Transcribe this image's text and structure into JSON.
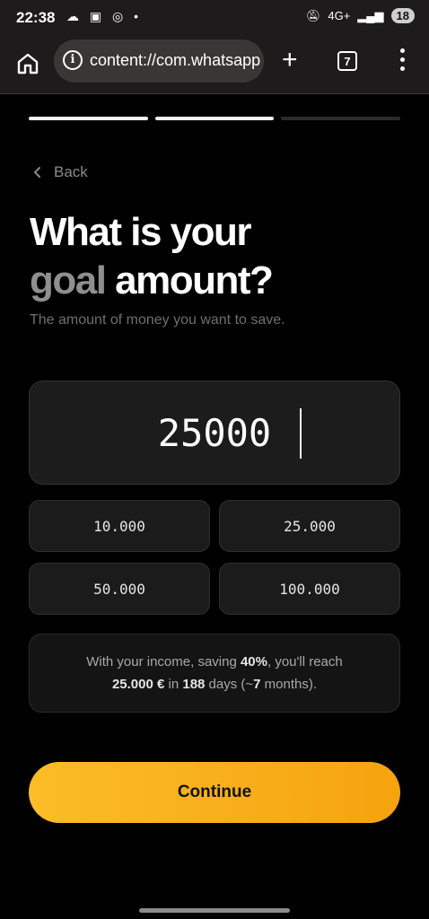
{
  "status_bar": {
    "time": "22:38",
    "network": "4G+",
    "battery": "18"
  },
  "browser": {
    "url": "content://com.whatsapp",
    "tab_count": "7"
  },
  "progress": {
    "steps_total": 3,
    "steps_done": 2
  },
  "nav": {
    "back_label": "Back"
  },
  "heading": {
    "line1": "What is your",
    "muted_word": "goal",
    "rest": " amount?"
  },
  "subtitle": "The amount of money you want to save.",
  "amount": {
    "value": "25000"
  },
  "presets": [
    "10.000",
    "25.000",
    "50.000",
    "100.000"
  ],
  "projection": {
    "p1": "With your income, saving ",
    "rate": "40%",
    "p2": ", you'll reach",
    "target": "25.000 €",
    "p3": " in ",
    "days": "188",
    "p4": " days (~",
    "months": "7",
    "p5": " months)."
  },
  "cta": {
    "label": "Continue",
    "colors": [
      "#fbbd28",
      "#f5a30f"
    ]
  }
}
